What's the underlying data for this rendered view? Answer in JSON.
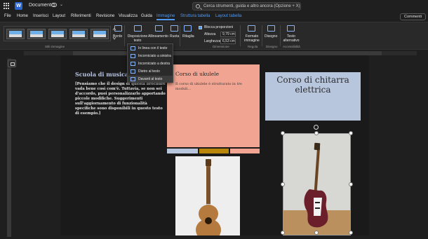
{
  "titlebar": {
    "doc_title": "Document 5",
    "search_placeholder": "Cerca strumenti, guida e altro ancora (Opzione + X)"
  },
  "tabs": [
    {
      "label": "File"
    },
    {
      "label": "Home"
    },
    {
      "label": "Inserisci"
    },
    {
      "label": "Layout"
    },
    {
      "label": "Riferimenti"
    },
    {
      "label": "Revisione"
    },
    {
      "label": "Visualizza"
    },
    {
      "label": "Guida"
    },
    {
      "label": "Immagine",
      "active": true
    },
    {
      "label": "Struttura tabella"
    },
    {
      "label": "Layout tabella"
    }
  ],
  "comments_label": "Commenti",
  "ribbon": {
    "styles_group": "Stili immagine",
    "bordo": "Bordo",
    "disposizione": "Disposizione testo",
    "allineamento": "Allineamento",
    "ruota": "Ruota",
    "ritaglia": "Ritaglia",
    "blocca_proporzioni": "Blocca proporzioni",
    "altezza_label": "Altezza",
    "altezza_value": "9,79 cm",
    "larghezza_label": "Larghezza",
    "larghezza_value": "6,53 cm",
    "dimensione_group": "Dimensione",
    "formato": "Formato immagine",
    "regola_group": "Regola",
    "disegno": "Disegno",
    "disegno_group": "Disegno",
    "testo_alt": "Testo alternativo",
    "accessibilita_group": "Accessibilità"
  },
  "wrap_menu": [
    {
      "label": "In linea con il testo"
    },
    {
      "label": "Incorniciato a sinistra"
    },
    {
      "label": "Incorniciato a destra"
    },
    {
      "label": "Dietro al testo"
    },
    {
      "label": "Davanti al testo",
      "selected": true
    }
  ],
  "document": {
    "scuola_title": "Scuola di musica Ar",
    "scuola_text": "[Pensiamo che il design di questa brochure vada bene così com'è. Tuttavia, se non sei d'accordo, puoi personalizzarlo apportando piccole modifiche. Suggerimenti sull'aggiornamento di funzionalità specifiche sono disponibili in questo testo di esempio.]",
    "ukulele_title": "Corso di ukulele",
    "ukulele_text": "Il corso di ukulele è strutturato in tre moduli...",
    "chitarra_title": "Corso di chitarra elettrica"
  },
  "colors": {
    "accent": "#4f9bf5",
    "salmon": "#f0a491",
    "light_blue": "#b8c6dd",
    "gold": "#b8860b"
  }
}
